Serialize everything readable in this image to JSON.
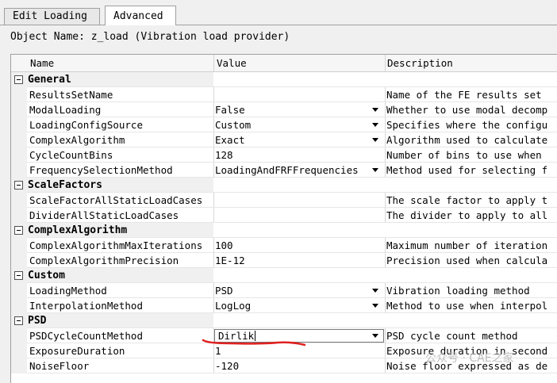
{
  "tabs": [
    {
      "label": "Edit Loading",
      "active": false
    },
    {
      "label": "Advanced",
      "active": true
    }
  ],
  "object_name": "Object Name: z_load (Vibration load provider)",
  "columns": {
    "name": "Name",
    "value": "Value",
    "description": "Description"
  },
  "categories": [
    {
      "label": "General",
      "rows": [
        {
          "name": "ResultsSetName",
          "value": "",
          "dropdown": false,
          "description": "Name of the FE results set"
        },
        {
          "name": "ModalLoading",
          "value": "False",
          "dropdown": true,
          "description": "Whether to use modal decomp"
        },
        {
          "name": "LoadingConfigSource",
          "value": "Custom",
          "dropdown": true,
          "description": "Specifies where the configu"
        },
        {
          "name": "ComplexAlgorithm",
          "value": "Exact",
          "dropdown": true,
          "description": "Algorithm used to calculate"
        },
        {
          "name": "CycleCountBins",
          "value": "128",
          "dropdown": false,
          "description": "Number of bins to use when"
        },
        {
          "name": "FrequencySelectionMethod",
          "value": "LoadingAndFRFFrequencies",
          "dropdown": true,
          "description": "Method used for selecting f"
        }
      ]
    },
    {
      "label": "ScaleFactors",
      "rows": [
        {
          "name": "ScaleFactorAllStaticLoadCases",
          "value": "",
          "dropdown": false,
          "description": "The scale factor to apply t"
        },
        {
          "name": "DividerAllStaticLoadCases",
          "value": "",
          "dropdown": false,
          "description": "The divider to apply to all"
        }
      ]
    },
    {
      "label": "ComplexAlgorithm",
      "rows": [
        {
          "name": "ComplexAlgorithmMaxIterations",
          "value": "100",
          "dropdown": false,
          "description": "Maximum number of iteration"
        },
        {
          "name": "ComplexAlgorithmPrecision",
          "value": "1E-12",
          "dropdown": false,
          "description": "Precision used when calcula"
        }
      ]
    },
    {
      "label": "Custom",
      "rows": [
        {
          "name": "LoadingMethod",
          "value": "PSD",
          "dropdown": true,
          "description": "Vibration loading method"
        },
        {
          "name": "InterpolationMethod",
          "value": "LogLog",
          "dropdown": true,
          "description": "Method to use when interpol"
        }
      ]
    },
    {
      "label": "PSD",
      "rows": [
        {
          "name": "PSDCycleCountMethod",
          "value": "Dirlik",
          "dropdown": true,
          "editing": true,
          "description": "PSD cycle count method"
        },
        {
          "name": "ExposureDuration",
          "value": "1",
          "dropdown": false,
          "description": "Exposure duration in second"
        },
        {
          "name": "NoiseFloor",
          "value": "-120",
          "dropdown": false,
          "description": "Noise floor expressed as de"
        }
      ]
    }
  ],
  "watermark": "公众号 · CAE之家",
  "colors": {
    "annotation_underline": "#e02020",
    "grid_background": "#ffffff",
    "window_background": "#f0f0f0"
  }
}
